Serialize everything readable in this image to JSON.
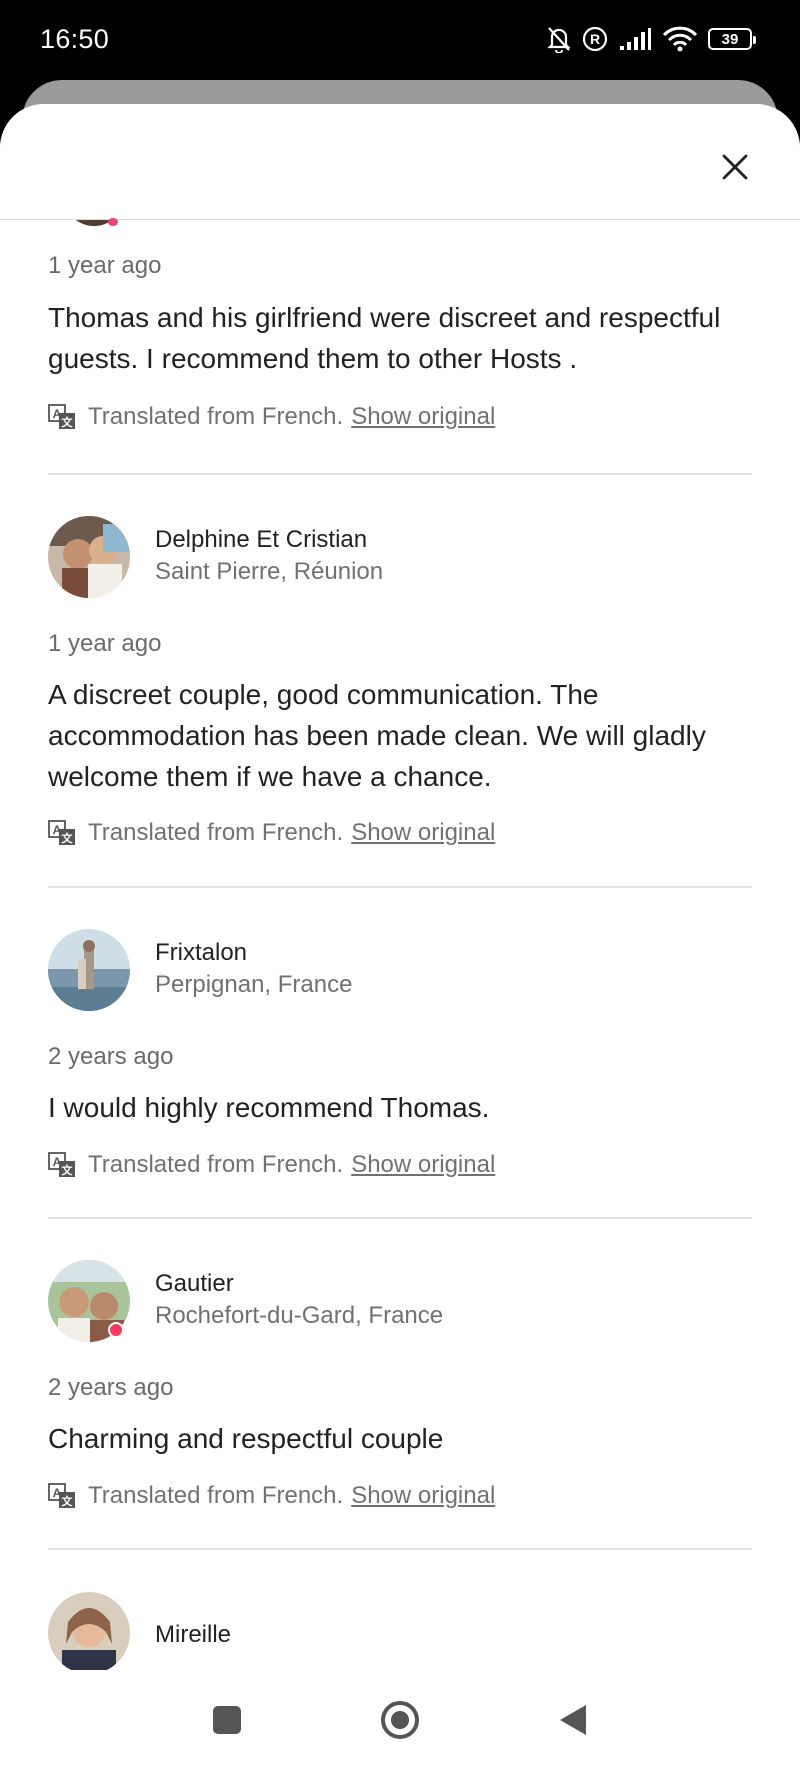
{
  "status_bar": {
    "time": "16:50",
    "battery": "39",
    "icons": [
      "mute-bell-icon",
      "registered-icon",
      "signal-icon",
      "wifi-icon",
      "battery-icon"
    ]
  },
  "header": {
    "close_icon": "close-icon"
  },
  "reviews": [
    {
      "date": "1 year ago",
      "text": "Thomas and his girlfriend were discreet and respectful guests. I recommend them to other Hosts .",
      "translated_label": "Translated from French.",
      "show_original": "Show original"
    },
    {
      "name": "Delphine Et Cristian",
      "location": "Saint Pierre, Réunion",
      "date": "1 year ago",
      "text": "A discreet couple, good communication. The accommodation has been made clean. We will gladly welcome them if we have a chance.",
      "translated_label": "Translated from French.",
      "show_original": "Show original"
    },
    {
      "name": "Frixtalon",
      "location": "Perpignan, France",
      "date": "2 years ago",
      "text": "I would highly recommend Thomas.",
      "translated_label": "Translated from French.",
      "show_original": "Show original"
    },
    {
      "name": "Gautier",
      "location": "Rochefort-du-Gard, France",
      "date": "2 years ago",
      "text": "Charming and respectful couple",
      "translated_label": "Translated from French.",
      "show_original": "Show original"
    },
    {
      "name": "Mireille"
    }
  ],
  "nav_bar": {
    "icons": [
      "recents-square-icon",
      "home-circle-icon",
      "back-triangle-icon"
    ]
  },
  "colors": {
    "accent_badge": "#ff385c",
    "text_primary": "#222222",
    "text_secondary": "#717171"
  }
}
